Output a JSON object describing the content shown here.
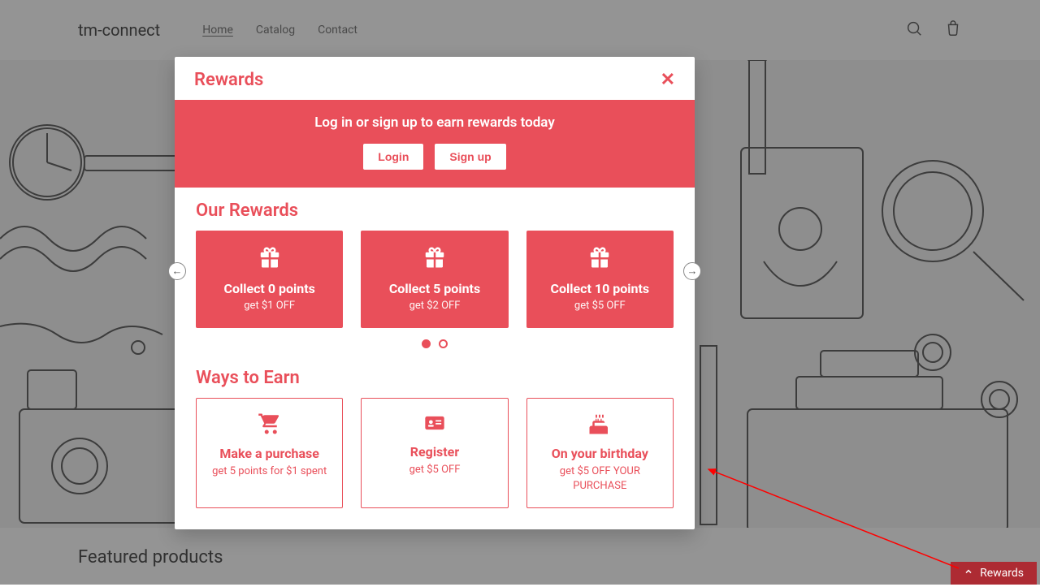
{
  "header": {
    "brand": "tm-connect",
    "nav": {
      "home": "Home",
      "catalog": "Catalog",
      "contact": "Contact"
    }
  },
  "featured_heading": "Featured products",
  "floating_tab": "Rewards",
  "modal": {
    "title": "Rewards",
    "auth": {
      "message": "Log in or sign up to earn rewards today",
      "login": "Login",
      "signup": "Sign up"
    },
    "rewards_section": {
      "heading": "Our Rewards",
      "cards": [
        {
          "title": "Collect 0 points",
          "sub": "get $1 OFF"
        },
        {
          "title": "Collect 5 points",
          "sub": "get $2 OFF"
        },
        {
          "title": "Collect 10 points",
          "sub": "get $5 OFF"
        }
      ]
    },
    "earn_section": {
      "heading": "Ways to Earn",
      "cards": [
        {
          "icon": "cart",
          "title": "Make a purchase",
          "sub": "get 5 points for $1 spent"
        },
        {
          "icon": "id",
          "title": "Register",
          "sub": "get $5 OFF"
        },
        {
          "icon": "cake",
          "title": "On your birthday",
          "sub": "get $5 OFF YOUR PURCHASE"
        }
      ]
    }
  }
}
